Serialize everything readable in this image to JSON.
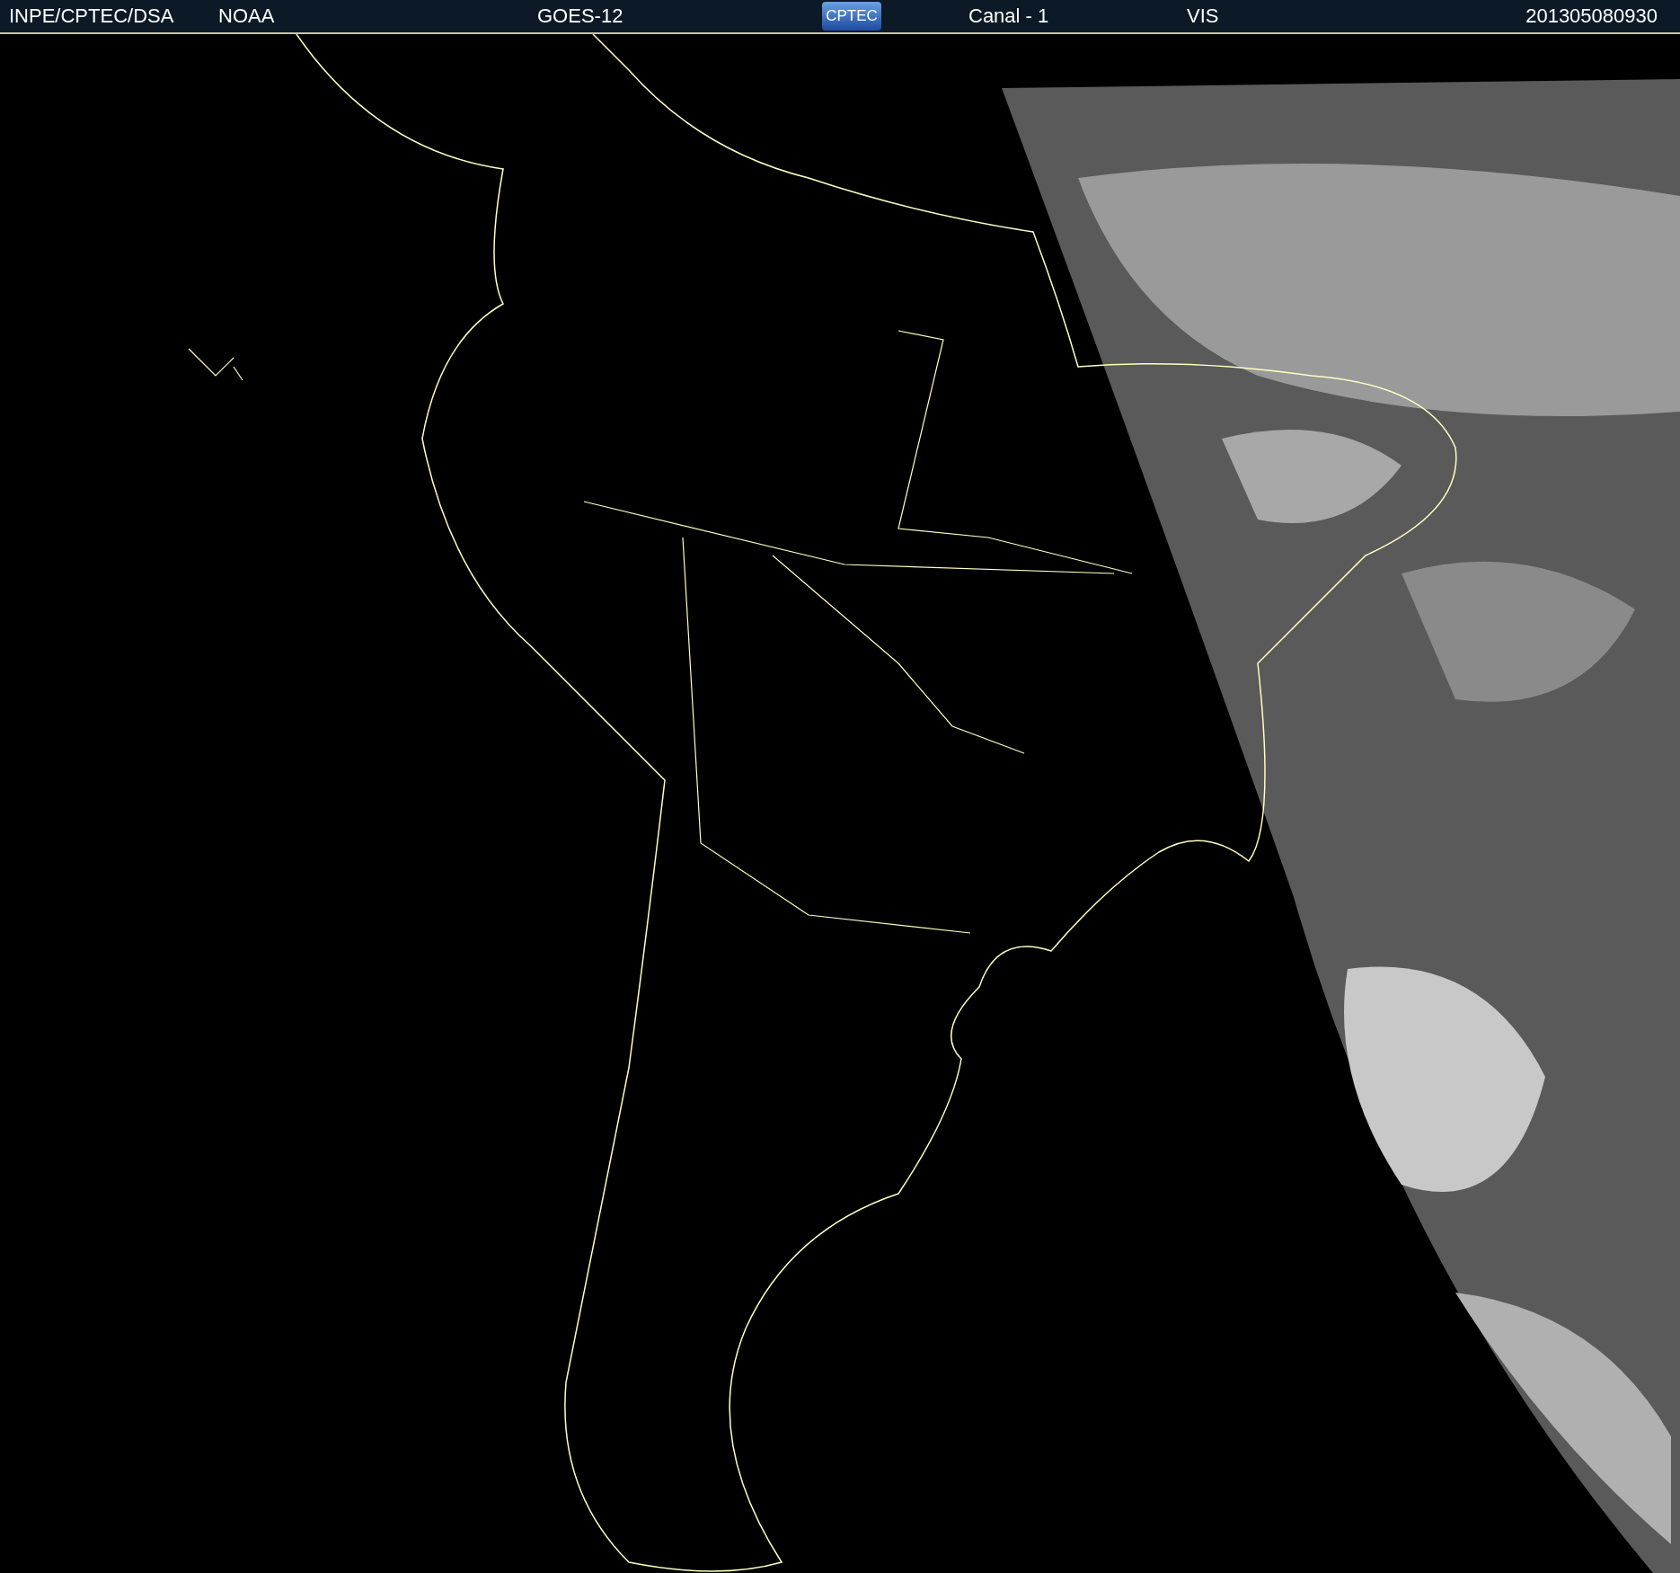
{
  "header": {
    "source": "INPE/CPTEC/DSA",
    "agency": "NOAA",
    "satellite": "GOES-12",
    "logo": "CPTEC",
    "channel": "Canal - 1",
    "band": "VIS",
    "timestamp": "201305080930"
  }
}
